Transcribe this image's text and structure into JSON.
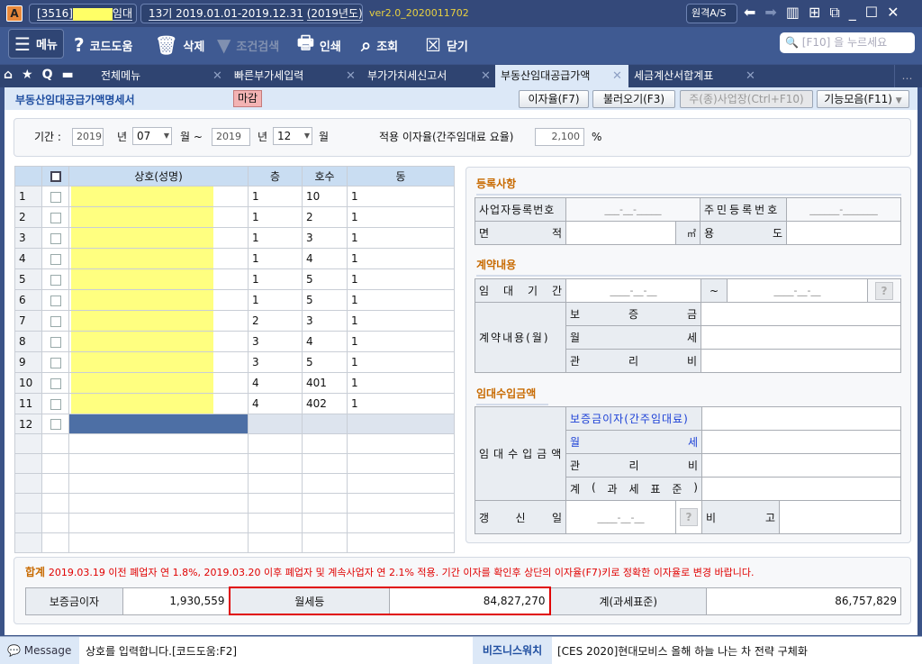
{
  "titlebar": {
    "company": "[3516]",
    "company_suffix": "임대",
    "period": "13기  2019.01.01-2019.12.31",
    "year": "(2019년도)",
    "version": "ver2.0_2020011702",
    "remote_as": "원격A/S",
    "colors": {
      "bg": "#34497a",
      "version": "#e8d040"
    }
  },
  "toolbar": {
    "menu": "메뉴",
    "code_help": "코드도움",
    "delete": "삭제",
    "search_cond": "조건검색",
    "print": "인쇄",
    "lookup": "조회",
    "close": "닫기",
    "search_placeholder": "[F10] 을 누르세요"
  },
  "tabs": [
    {
      "label": "전체메뉴"
    },
    {
      "label": "빠른부가세입력"
    },
    {
      "label": "부가가치세신고서"
    },
    {
      "label": "부동산임대공급가액",
      "active": true
    },
    {
      "label": "세금계산서합계표"
    }
  ],
  "subheader": {
    "title": "부동산임대공급가액명세서",
    "badge": "마감",
    "btn_rate": "이자율(F7)",
    "btn_load": "불러오기(F3)",
    "btn_site": "주(종)사업장(Ctrl+F10)",
    "btn_func": "기능모음(F11)"
  },
  "filter": {
    "period_label": "기간 :",
    "from_year": "2019",
    "year_unit": "년",
    "from_month": "07",
    "month_unit": "월 ~",
    "to_year": "2019",
    "to_month": "12",
    "month_unit2": "월",
    "rate_label": "적용 이자율(간주임대료 요율)",
    "rate": "2,100",
    "pct": "%"
  },
  "grid": {
    "headers": [
      "상호(성명)",
      "층",
      "호수",
      "동"
    ],
    "rows": [
      [
        "1",
        "1",
        "10",
        "1"
      ],
      [
        "2",
        "1",
        "2",
        "1"
      ],
      [
        "3",
        "1",
        "3",
        "1"
      ],
      [
        "4",
        "1",
        "4",
        "1"
      ],
      [
        "5",
        "1",
        "5",
        "1"
      ],
      [
        "6",
        "1",
        "5",
        "1"
      ],
      [
        "7",
        "2",
        "3",
        "1"
      ],
      [
        "8",
        "3",
        "4",
        "1"
      ],
      [
        "9",
        "3",
        "5",
        "1"
      ],
      [
        "10",
        "4",
        "401",
        "1"
      ],
      [
        "11",
        "4",
        "402",
        "1"
      ],
      [
        "12",
        "",
        "",
        ""
      ]
    ]
  },
  "detail": {
    "sec_reg": "등록사항",
    "biz_no_label": "사업자등록번호",
    "biz_no": "___-__-_____",
    "resident_no_label": "주민등록번호",
    "resident_no": "______-_______",
    "area_label": [
      "면",
      "적"
    ],
    "area_unit": "㎡",
    "usage_label": [
      "용",
      "도"
    ],
    "sec_contract": "계약내용",
    "lease_period_label": [
      "임",
      "대",
      "기",
      "간"
    ],
    "date_mask": "____-__-__",
    "tilde": "~",
    "contract_label": "계약내용(월)",
    "deposit_label": [
      "보",
      "증",
      "금"
    ],
    "monthly_label": [
      "월",
      "세"
    ],
    "mgmt_label": [
      "관",
      "리",
      "비"
    ],
    "sec_income": "임대수입금액",
    "income_label": "임대수입금액",
    "deposit_interest_label": "보증금이자(간주임대료)",
    "tax_base_label": [
      "계",
      "(",
      "과",
      "세",
      "표",
      "준",
      ")"
    ],
    "renewal_label": [
      "갱",
      "신",
      "일"
    ],
    "note_label": [
      "비",
      "고"
    ],
    "help": "?"
  },
  "summary": {
    "title": "합계",
    "notice": "2019.03.19 이전 폐업자 연 1.8%, 2019.03.20 이후 폐업자 및 계속사업자 연 2.1% 적용. 기간 이자를 확인후 상단의 이자율(F7)키로 정확한 이자율로 변경 바랍니다.",
    "deposit_interest_label": "보증금이자",
    "deposit_interest": "1,930,559",
    "monthly_label": "월세등",
    "monthly": "84,827,270",
    "total_label": "계(과세표준)",
    "total": "86,757,829"
  },
  "status": {
    "message_label": "Message",
    "message": "상호를 입력합니다.[코드도움:F2]",
    "news_label": "비즈니스워치",
    "news": "[CES 2020]현대모비스 올해 하늘 나는 차 전략 구체화"
  }
}
